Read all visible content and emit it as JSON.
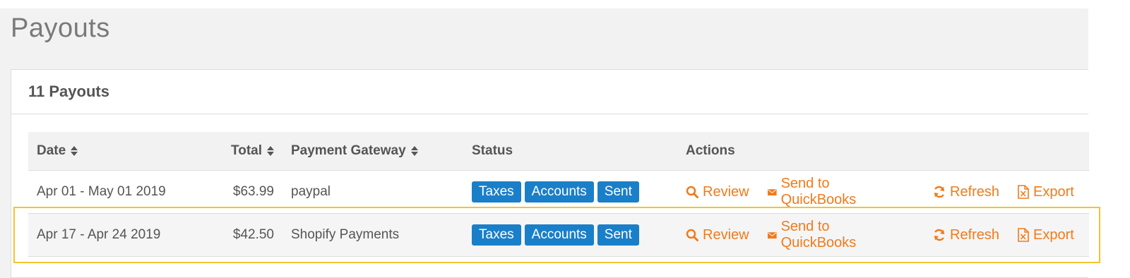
{
  "page": {
    "title": "Payouts"
  },
  "panel": {
    "title": "11 Payouts"
  },
  "table": {
    "columns": {
      "date": "Date",
      "total": "Total",
      "gateway": "Payment Gateway",
      "status": "Status",
      "actions": "Actions"
    },
    "rows": [
      {
        "date": "Apr 01 - May 01 2019",
        "total": "$63.99",
        "gateway": "paypal",
        "status": [
          "Taxes",
          "Accounts",
          "Sent"
        ],
        "actions": {
          "review": "Review",
          "send": "Send to QuickBooks",
          "refresh": "Refresh",
          "export": "Export"
        }
      },
      {
        "date": "Apr 17 - Apr 24 2019",
        "total": "$42.50",
        "gateway": "Shopify Payments",
        "status": [
          "Taxes",
          "Accounts",
          "Sent"
        ],
        "actions": {
          "review": "Review",
          "send": "Send to QuickBooks",
          "refresh": "Refresh",
          "export": "Export"
        }
      }
    ]
  },
  "colors": {
    "badge": "#1a7fc9",
    "action": "#f27a1a",
    "highlight": "#f4c430"
  },
  "icons": {
    "review": "search-icon",
    "send": "envelope-icon",
    "refresh": "refresh-icon",
    "export": "file-excel-icon",
    "sort": "sort-icon"
  }
}
